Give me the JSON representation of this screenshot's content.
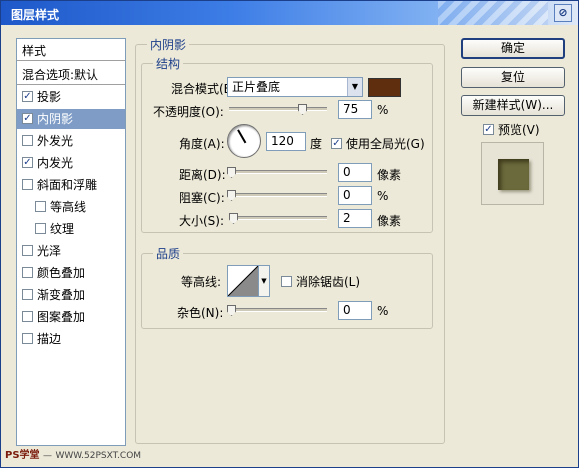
{
  "window": {
    "title": "图层样式",
    "close": "⊘"
  },
  "sidebar": {
    "items": [
      {
        "label": "样式",
        "checkbox": false
      },
      {
        "label": "混合选项:默认",
        "checkbox": false
      },
      {
        "label": "投影",
        "checkbox": true,
        "checked": true
      },
      {
        "label": "内阴影",
        "checkbox": true,
        "checked": true,
        "selected": true
      },
      {
        "label": "外发光",
        "checkbox": true,
        "checked": false
      },
      {
        "label": "内发光",
        "checkbox": true,
        "checked": true
      },
      {
        "label": "斜面和浮雕",
        "checkbox": true,
        "checked": false
      },
      {
        "label": "等高线",
        "checkbox": true,
        "checked": false
      },
      {
        "label": "纹理",
        "checkbox": true,
        "checked": false
      },
      {
        "label": "光泽",
        "checkbox": true,
        "checked": false
      },
      {
        "label": "颜色叠加",
        "checkbox": true,
        "checked": false
      },
      {
        "label": "渐变叠加",
        "checkbox": true,
        "checked": false
      },
      {
        "label": "图案叠加",
        "checkbox": true,
        "checked": false
      },
      {
        "label": "描边",
        "checkbox": true,
        "checked": false
      }
    ]
  },
  "inner_shadow": {
    "section_title": "内阴影",
    "structure": {
      "title": "结构",
      "blend_mode_label": "混合模式(B):",
      "blend_mode_value": "正片叠底",
      "blend_color": "#5e2e0f",
      "opacity_label": "不透明度(O):",
      "opacity_value": "75",
      "opacity_unit": "%",
      "opacity_level": 0.75,
      "angle_label": "角度(A):",
      "angle_value": "120",
      "angle_unit": "度",
      "global_light_label": "使用全局光(G)",
      "global_light_checked": true,
      "distance_label": "距离(D):",
      "distance_value": "0",
      "distance_unit": "像素",
      "choke_label": "阻塞(C):",
      "choke_value": "0",
      "choke_unit": "%",
      "size_label": "大小(S):",
      "size_value": "2",
      "size_unit": "像素"
    },
    "quality": {
      "title": "品质",
      "contour_label": "等高线:",
      "antialias_label": "消除锯齿(L)",
      "antialias_checked": false,
      "noise_label": "杂色(N):",
      "noise_value": "0",
      "noise_unit": "%"
    }
  },
  "buttons": {
    "ok": "确定",
    "reset": "复位",
    "new_style": "新建样式(W)...",
    "preview_label": "预览(V)",
    "preview_checked": true
  },
  "watermark": {
    "brand": "PS学堂",
    "url": "WWW.52PSXT.COM"
  },
  "colors": {
    "selection": "#7e9cc6",
    "title_blue": "#1e58c9",
    "preview_swatch": "#6b6a3c"
  }
}
